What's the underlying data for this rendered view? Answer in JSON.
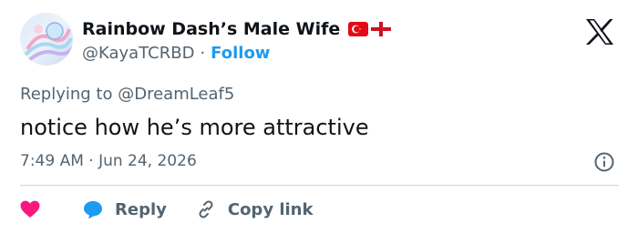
{
  "user": {
    "display_name": "Rainbow Dash’s Male Wife",
    "handle": "@KayaTCRBD",
    "separator": "·",
    "follow_label": "Follow",
    "flags": [
      "turkey-flag-icon",
      "england-flag-icon"
    ]
  },
  "tweet": {
    "replying_prefix": "Replying to",
    "replying_to": "@DreamLeaf5",
    "text": "notice how he’s more attractive",
    "timestamp": "7:49 AM · Jun 24, 2026"
  },
  "actions": {
    "like_icon": "heart-icon",
    "reply_label": "Reply",
    "copy_link_label": "Copy link"
  },
  "colors": {
    "accent": "#1d9bf0",
    "like": "#f91880",
    "text": "#0f1419",
    "muted": "#536471",
    "divider": "#cfd9de"
  }
}
